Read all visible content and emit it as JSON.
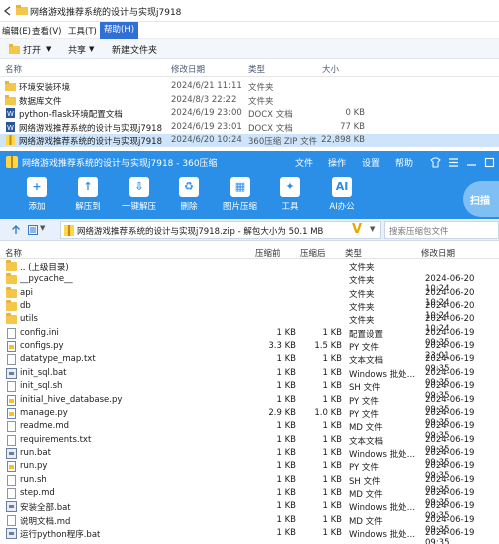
{
  "explorer": {
    "title": "网络游戏推荐系统的设计与实现j7918",
    "menu": [
      "编辑(E)",
      "查看(V)",
      "工具(T)",
      "帮助(H)"
    ],
    "toolbar": {
      "open": "打开",
      "share": "共享",
      "new_folder": "新建文件夹"
    },
    "columns": {
      "name": "名称",
      "date": "修改日期",
      "type": "类型",
      "size": "大小"
    },
    "rows": [
      {
        "name": "环境安装环境",
        "date": "2024/6/21 11:11",
        "type": "文件夹",
        "size": "",
        "icon": "folder-icon"
      },
      {
        "name": "数据库文件",
        "date": "2024/8/3 22:22",
        "type": "文件夹",
        "size": "",
        "icon": "folder-icon"
      },
      {
        "name": "python-flask环境配置文档",
        "date": "2024/6/19 23:00",
        "type": "DOCX 文档",
        "size": "0 KB",
        "icon": "docx-icon"
      },
      {
        "name": "网络游戏推荐系统的设计与实现j7918",
        "date": "2024/6/19 23:01",
        "type": "DOCX 文档",
        "size": "77 KB",
        "icon": "docx-icon"
      },
      {
        "name": "网络游戏推荐系统的设计与实现j7918",
        "date": "2024/6/20 10:24",
        "type": "360压缩 ZIP 文件",
        "size": "22,898 KB",
        "icon": "zip-icon"
      }
    ]
  },
  "zip": {
    "title": "网络游戏推荐系统的设计与实现j7918 - 360压缩",
    "title_menu": [
      "文件",
      "操作",
      "设置",
      "帮助"
    ],
    "tools": [
      {
        "label": "添加",
        "icon": "add-icon"
      },
      {
        "label": "解压到",
        "icon": "extract-to-icon"
      },
      {
        "label": "一键解压",
        "icon": "one-click-extract-icon"
      },
      {
        "label": "删除",
        "icon": "delete-icon"
      },
      {
        "label": "图片压缩",
        "icon": "image-compress-icon"
      },
      {
        "label": "工具",
        "icon": "tools-icon"
      },
      {
        "label": "AI办公",
        "icon": "ai-office-icon"
      }
    ],
    "scan_label": "扫描",
    "path": "网络游戏推荐系统的设计与实现j7918.zip - 解包大小为 50.1 MB",
    "search_placeholder": "搜索压缩包文件",
    "columns": {
      "name": "名称",
      "compressed": "压缩前",
      "after": "压缩后",
      "type": "类型",
      "date": "修改日期"
    },
    "rows": [
      {
        "name": ".. (上级目录)",
        "c": "",
        "a": "",
        "type": "文件夹",
        "date": "",
        "icon": "folder"
      },
      {
        "name": "__pycache__",
        "c": "",
        "a": "",
        "type": "文件夹",
        "date": "2024-06-20 10:24",
        "icon": "folder"
      },
      {
        "name": "api",
        "c": "",
        "a": "",
        "type": "文件夹",
        "date": "2024-06-20 10:24",
        "icon": "folder"
      },
      {
        "name": "db",
        "c": "",
        "a": "",
        "type": "文件夹",
        "date": "2024-06-20 10:24",
        "icon": "folder"
      },
      {
        "name": "utils",
        "c": "",
        "a": "",
        "type": "文件夹",
        "date": "2024-06-20 10:24",
        "icon": "folder"
      },
      {
        "name": "config.ini",
        "c": "1 KB",
        "a": "1 KB",
        "type": "配置设置",
        "date": "2024-06-19 09:35",
        "icon": "file"
      },
      {
        "name": "configs.py",
        "c": "3.3 KB",
        "a": "1.5 KB",
        "type": "PY 文件",
        "date": "2024-06-19 23:01",
        "icon": "py"
      },
      {
        "name": "datatype_map.txt",
        "c": "1 KB",
        "a": "1 KB",
        "type": "文本文档",
        "date": "2024-06-19 09:35",
        "icon": "file"
      },
      {
        "name": "init_sql.bat",
        "c": "1 KB",
        "a": "1 KB",
        "type": "Windows 批处理...",
        "date": "2024-06-19 09:35",
        "icon": "bat"
      },
      {
        "name": "init_sql.sh",
        "c": "1 KB",
        "a": "1 KB",
        "type": "SH 文件",
        "date": "2024-06-19 09:35",
        "icon": "file"
      },
      {
        "name": "initial_hive_database.py",
        "c": "1 KB",
        "a": "1 KB",
        "type": "PY 文件",
        "date": "2024-06-19 09:35",
        "icon": "py"
      },
      {
        "name": "manage.py",
        "c": "2.9 KB",
        "a": "1.0 KB",
        "type": "PY 文件",
        "date": "2024-06-19 09:35",
        "icon": "py"
      },
      {
        "name": "readme.md",
        "c": "1 KB",
        "a": "1 KB",
        "type": "MD 文件",
        "date": "2024-06-19 09:35",
        "icon": "file"
      },
      {
        "name": "requirements.txt",
        "c": "1 KB",
        "a": "1 KB",
        "type": "文本文档",
        "date": "2024-06-19 09:35",
        "icon": "file"
      },
      {
        "name": "run.bat",
        "c": "1 KB",
        "a": "1 KB",
        "type": "Windows 批处理...",
        "date": "2024-06-19 09:35",
        "icon": "bat"
      },
      {
        "name": "run.py",
        "c": "1 KB",
        "a": "1 KB",
        "type": "PY 文件",
        "date": "2024-06-19 09:35",
        "icon": "py"
      },
      {
        "name": "run.sh",
        "c": "1 KB",
        "a": "1 KB",
        "type": "SH 文件",
        "date": "2024-06-19 09:35",
        "icon": "file"
      },
      {
        "name": "step.md",
        "c": "1 KB",
        "a": "1 KB",
        "type": "MD 文件",
        "date": "2024-06-19 09:35",
        "icon": "file"
      },
      {
        "name": "安装全部.bat",
        "c": "1 KB",
        "a": "1 KB",
        "type": "Windows 批处理...",
        "date": "2024-06-19 09:35",
        "icon": "bat"
      },
      {
        "name": "说明文档.md",
        "c": "1 KB",
        "a": "1 KB",
        "type": "MD 文件",
        "date": "2024-06-19 09:35",
        "icon": "file"
      },
      {
        "name": "运行python程序.bat",
        "c": "1 KB",
        "a": "1 KB",
        "type": "Windows 批处理...",
        "date": "2024-06-19 09:35",
        "icon": "bat"
      }
    ]
  },
  "colors": {
    "zip_blue": "#2b8fe8",
    "selected_row": "#cde4fb",
    "folder": "#f4c64a"
  }
}
